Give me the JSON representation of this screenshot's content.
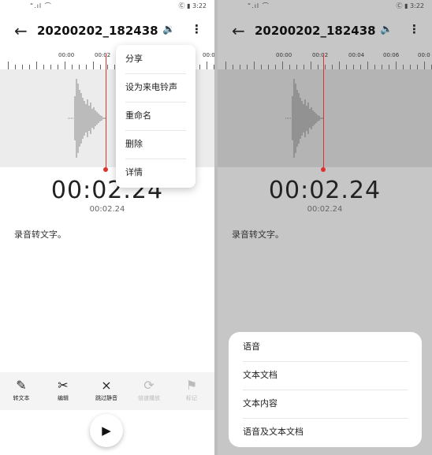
{
  "status": {
    "signal": "“.ıl ⌒",
    "right": "Ⓒ ▮ 3:22"
  },
  "recording": {
    "name": "20200202_182438",
    "elapsed": "00:02.24",
    "elapsed_small": "00:02.24",
    "transcript": "录音转文字。"
  },
  "ruler": {
    "left_labels": [
      "00:00",
      "00:02",
      "00:0"
    ],
    "right_labels": [
      "00:00",
      "00:02",
      "00:04",
      "00:06",
      "00:0"
    ]
  },
  "icons": {
    "back": "←",
    "volume": "🔉",
    "more": "⋮",
    "play": "▶"
  },
  "menu": {
    "items": [
      "分享",
      "设为来电铃声",
      "重命名",
      "删除",
      "详情"
    ]
  },
  "toolbar": {
    "items": [
      {
        "label": "转文本",
        "icon": "✎"
      },
      {
        "label": "编辑",
        "icon": "✂"
      },
      {
        "label": "跳过静音",
        "icon": "⨯"
      },
      {
        "label": "倍速播放",
        "icon": "⟳"
      },
      {
        "label": "标记",
        "icon": "⚑"
      }
    ]
  },
  "share_sheet": {
    "items": [
      "语音",
      "文本文档",
      "文本内容",
      "语音及文本文档"
    ]
  },
  "colors": {
    "accent": "#e03131"
  }
}
